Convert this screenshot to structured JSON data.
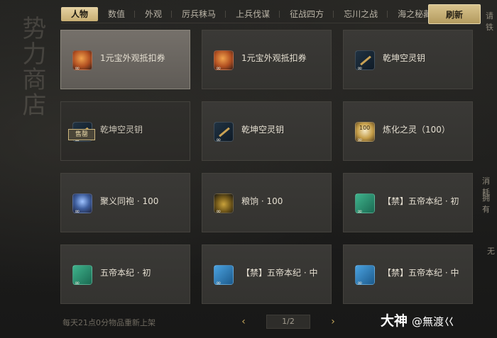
{
  "side_title": "势力商店",
  "tabs": [
    {
      "label": "人物",
      "active": true
    },
    {
      "label": "数值",
      "active": false
    },
    {
      "label": "外观",
      "active": false
    },
    {
      "label": "厉兵秣马",
      "active": false
    },
    {
      "label": "上兵伐谋",
      "active": false
    },
    {
      "label": "征战四方",
      "active": false
    },
    {
      "label": "忘川之战",
      "active": false
    },
    {
      "label": "海之秘藏",
      "active": false
    }
  ],
  "refresh_label": "刷新",
  "edge": {
    "top": "请铁",
    "consume": "消耗",
    "own": "拥有",
    "none": "无"
  },
  "infinity_symbol": "∞",
  "sold_out_label": "售罄",
  "items": [
    {
      "name": "1元宝外观抵扣券",
      "icon": "coupon-icon",
      "selected": true,
      "sold_out": false
    },
    {
      "name": "1元宝外观抵扣券",
      "icon": "coupon-icon",
      "selected": false,
      "sold_out": false
    },
    {
      "name": "乾坤空灵钥",
      "icon": "key-icon",
      "selected": false,
      "sold_out": false
    },
    {
      "name": "乾坤空灵钥",
      "icon": "key-icon",
      "selected": false,
      "sold_out": true
    },
    {
      "name": "乾坤空灵钥",
      "icon": "key-icon",
      "selected": false,
      "sold_out": false
    },
    {
      "name": "炼化之灵（100）",
      "icon": "spirit-icon",
      "selected": false,
      "sold_out": false
    },
    {
      "name": "聚义同袍 · 100",
      "icon": "robe-icon",
      "selected": false,
      "sold_out": false
    },
    {
      "name": "粮饷 · 100",
      "icon": "food-icon",
      "selected": false,
      "sold_out": false
    },
    {
      "name": "【禁】五帝本纪 · 初",
      "icon": "book-green-icon",
      "selected": false,
      "sold_out": false
    },
    {
      "name": "五帝本纪 · 初",
      "icon": "book-green-icon",
      "selected": false,
      "sold_out": false
    },
    {
      "name": "【禁】五帝本纪 · 中",
      "icon": "book-blue-icon",
      "selected": false,
      "sold_out": false
    },
    {
      "name": "【禁】五帝本纪 · 中",
      "icon": "book-blue-icon",
      "selected": false,
      "sold_out": false
    }
  ],
  "footer_note": "每天21点0分物品重新上架",
  "pager": {
    "current": "1/2",
    "prev": "‹",
    "next": "›"
  },
  "watermark": {
    "brand": "大神",
    "handle": "@無渡巜"
  }
}
